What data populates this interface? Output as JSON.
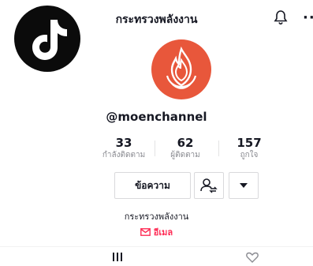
{
  "header": {
    "title": "กระทรวงพลังงาน",
    "more_label": "··"
  },
  "profile": {
    "username": "@moenchannel",
    "bio_name": "กระทรวงพลังงาน",
    "email_label": "อีเมล"
  },
  "stats": [
    {
      "value": "33",
      "label": "กำลังติดตาม"
    },
    {
      "value": "62",
      "label": "ผู้ติดตาม"
    },
    {
      "value": "157",
      "label": "ถูกใจ"
    }
  ],
  "actions": {
    "message_label": "ข้อความ"
  },
  "tabs": {
    "grid_glyph": "|||"
  },
  "colors": {
    "accent": "#fe2c55",
    "avatar": "#e8573b"
  },
  "icons": [
    "tiktok-logo",
    "bell-icon",
    "more-icon",
    "follow-user-icon",
    "dropdown-arrow-icon",
    "mail-icon",
    "grid-icon",
    "liked-icon"
  ]
}
